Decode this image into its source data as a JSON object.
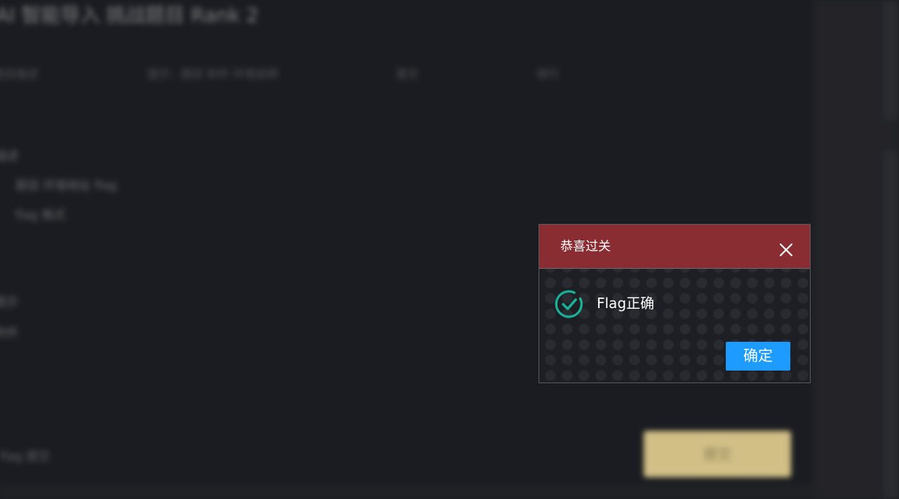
{
  "background": {
    "title": "AI 智能导入 挑战题目 Rank 2",
    "tabs": [
      "题目描述",
      "提示：题目 附件 环境说明",
      "提交",
      "排行"
    ],
    "lines": [
      "描述",
      "题目 环境地址 flag",
      "flag 格式 ",
      "提示",
      "附件"
    ],
    "footer_text": "flag 提交",
    "submit_label": "提交"
  },
  "dialog": {
    "title": "恭喜过关",
    "close_icon": "close-icon",
    "status_icon": "check-circle-icon",
    "message": "Flag正确",
    "confirm_label": "确定",
    "colors": {
      "header": "#8a2d33",
      "success": "#18b096",
      "primary": "#1e9bff"
    }
  }
}
